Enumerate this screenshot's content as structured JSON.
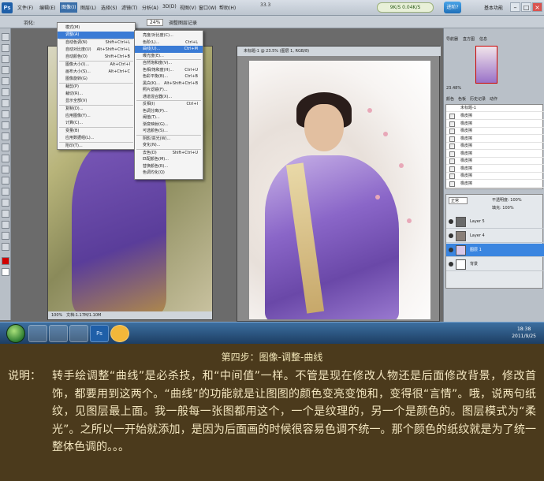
{
  "menubar": {
    "logo": "Ps",
    "items": [
      "文件(F)",
      "编辑(E)",
      "图像(I)",
      "图层(L)",
      "选择(S)",
      "滤镜(T)",
      "分析(A)",
      "3D(D)",
      "视图(V)",
      "窗口(W)",
      "帮助(H)"
    ],
    "zoom": "33.3",
    "badge": "9K/S  0.04K/S",
    "qq_button": "进阶?",
    "workspace": "基本功能"
  },
  "image_menu": {
    "items": [
      "模式(M)",
      "调整(A)",
      "自动色调(N)",
      "自动对比度(U)",
      "自动颜色(O)",
      "图像大小(I)...",
      "画布大小(S)...",
      "图像旋转(G)",
      "裁剪(P)",
      "裁切(R)...",
      "显示全部(V)",
      "复制(D)...",
      "应用图像(Y)...",
      "计算(C)...",
      "变量(B)",
      "应用数据组(L)...",
      "陷印(T)..."
    ],
    "shortcuts": [
      "",
      "",
      "Shift+Ctrl+L",
      "Alt+Shift+Ctrl+L",
      "Shift+Ctrl+B",
      "Alt+Ctrl+I",
      "Alt+Ctrl+C",
      "",
      "",
      "",
      "",
      "",
      "",
      "",
      "",
      "",
      ""
    ]
  },
  "adjust_menu": {
    "items": [
      "亮度/对比度(C)...",
      "色阶(L)...",
      "曲线(U)...",
      "曝光度(E)...",
      "自然饱和度(V)...",
      "色相/饱和度(H)...",
      "色彩平衡(B)...",
      "黑白(K)...",
      "照片滤镜(F)...",
      "通道混合器(X)...",
      "反相(I)",
      "色调分离(P)...",
      "阈值(T)...",
      "渐变映射(G)...",
      "可选颜色(S)...",
      "阴影/高光(W)...",
      "变化(N)...",
      "去色(D)",
      "匹配颜色(M)...",
      "替换颜色(R)...",
      "色调均化(Q)"
    ],
    "shortcuts": [
      "",
      "Ctrl+L",
      "Ctrl+M",
      "",
      "",
      "Ctrl+U",
      "Ctrl+B",
      "Alt+Shift+Ctrl+B",
      "",
      "",
      "Ctrl+I",
      "",
      "",
      "",
      "",
      "",
      "",
      "Shift+Ctrl+U",
      "",
      "",
      ""
    ],
    "highlighted": "曲线(U)..."
  },
  "options_bar": {
    "feather_label": "羽化:",
    "mode_label": "正常",
    "zoom_value": "24%",
    "history_btn": "调整图层记录"
  },
  "canvas1": {
    "status_zoom": "100%",
    "status_doc": "文档:1.17M/1.10M"
  },
  "canvas2": {
    "tab_title": "未标题-1 @ 23.5% (图层 1, RGB/8)"
  },
  "right_panel": {
    "nav_tabs": [
      "导航器",
      "直方图",
      "信息"
    ],
    "nav_zoom": "23.48%",
    "history_tabs": [
      "颜色",
      "色板",
      "历史记录",
      "动作"
    ],
    "history_doc": "未标题-1",
    "history_rows": [
      "橡皮擦",
      "橡皮擦",
      "橡皮擦",
      "橡皮擦",
      "橡皮擦",
      "橡皮擦",
      "橡皮擦",
      "橡皮擦",
      "橡皮擦",
      "橡皮擦"
    ],
    "layers_blend": "正常",
    "layers_opacity": "不透明度: 100%",
    "layers_fill": "填充: 100%",
    "layers": [
      {
        "name": "Layer 5",
        "selected": false
      },
      {
        "name": "Layer 4",
        "selected": false
      },
      {
        "name": "图层 1",
        "selected": true
      },
      {
        "name": "背景",
        "selected": false
      }
    ]
  },
  "taskbar": {
    "apps": [
      "未标题-1",
      "",
      "",
      "Ps",
      ""
    ],
    "time": "18:38",
    "date": "2011/9/25"
  },
  "caption": {
    "title": "第四步：图像-调整-曲线",
    "label": "说明：",
    "body": "转手绘调整“曲线”是必杀技，和“中间值”一样。不管是现在修改人物还是后面修改背景，修改首饰，都要用到这两个。“曲线”的功能就是让图图的颜色变亮变饱和，变得很“言情”。哦，说两句纸纹，见图层最上面。我一般每一张图都用这个，一个是纹理的，另一个是颜色的。图层模式为“柔光”。之所以一开始就添加，是因为后面画的时候很容易色调不统一。那个颜色的纸纹就是为了统一整体色调的。。。"
  }
}
